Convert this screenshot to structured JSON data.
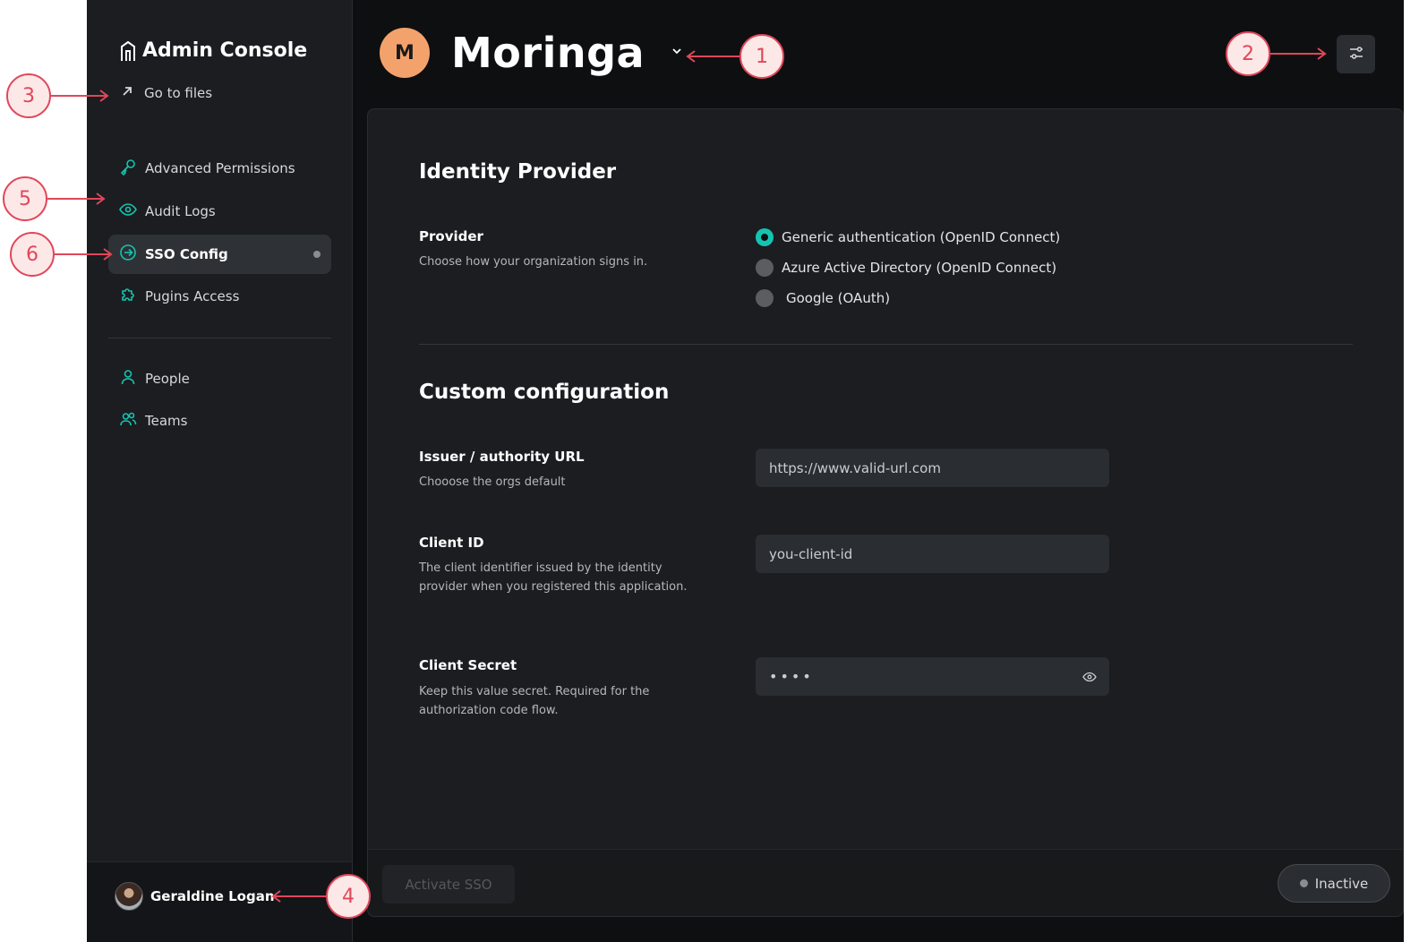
{
  "brand": {
    "title": "Admin Console",
    "icon": "building-icon"
  },
  "sidebar": {
    "goto_files": "Go to files",
    "items": [
      {
        "label": "Advanced Permissions",
        "icon": "key-icon"
      },
      {
        "label": "Audit Logs",
        "icon": "eye-icon"
      },
      {
        "label": "SSO Config",
        "icon": "arrow-circle-icon",
        "active": true
      },
      {
        "label": "Pugins Access",
        "icon": "puzzle-icon"
      },
      {
        "label": "People",
        "icon": "user-icon"
      },
      {
        "label": "Teams",
        "icon": "users-icon"
      }
    ],
    "user_name": "Geraldine Logan"
  },
  "header": {
    "workspace_initial": "M",
    "workspace_name": "Moringa"
  },
  "identity": {
    "title": "Identity Provider",
    "provider_label": "Provider",
    "provider_help": "Choose how your organization signs in.",
    "options": [
      {
        "label": "Generic authentication (OpenID Connect)",
        "selected": true
      },
      {
        "label": "Azure Active Directory (OpenID Connect)",
        "selected": false
      },
      {
        "label": "Google (OAuth)",
        "selected": false
      }
    ]
  },
  "custom": {
    "title": "Custom configuration",
    "issuer_label": "Issuer / authority URL",
    "issuer_help": "Chooose the orgs default",
    "issuer_value": "https://www.valid-url.com",
    "client_id_label": "Client ID",
    "client_id_help": "The client identifier issued by the identity provider when you registered this application.",
    "client_id_value": "you-client-id",
    "secret_label": "Client Secret",
    "secret_help": "Keep this value secret. Required for the authorization code flow.",
    "secret_value": "••••"
  },
  "footer": {
    "activate_label": "Activate SSO",
    "status_label": "Inactive"
  },
  "callouts": [
    "1",
    "2",
    "3",
    "4",
    "5",
    "6"
  ],
  "colors": {
    "accent": "#14c4b0",
    "workspace_avatar": "#f4a26b",
    "callout": "#e0475a",
    "background": "#0e0f11"
  }
}
